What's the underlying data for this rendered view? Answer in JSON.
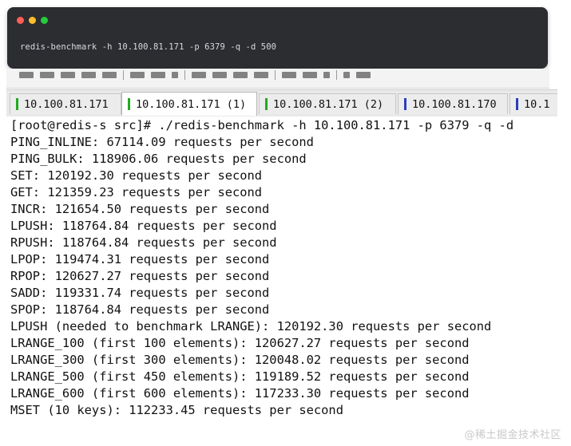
{
  "code_card": {
    "dot_colors": [
      "#ff5f56",
      "#ffbd2e",
      "#27c93f"
    ],
    "command": "redis-benchmark -h 10.100.81.171 -p 6379 -q -d 500"
  },
  "tabs": [
    {
      "label": "10.100.81.171",
      "marker": "green",
      "active": false
    },
    {
      "label": "10.100.81.171 (1)",
      "marker": "green",
      "active": true
    },
    {
      "label": "10.100.81.171 (2)",
      "marker": "green",
      "active": false
    },
    {
      "label": "10.100.81.170",
      "marker": "blue",
      "active": false
    },
    {
      "label": "10.1",
      "marker": "blue",
      "active": false
    }
  ],
  "terminal": {
    "lines": [
      "[root@redis-s src]# ./redis-benchmark -h 10.100.81.171 -p 6379 -q -d",
      "PING_INLINE: 67114.09 requests per second",
      "PING_BULK: 118906.06 requests per second",
      "SET: 120192.30 requests per second",
      "GET: 121359.23 requests per second",
      "INCR: 121654.50 requests per second",
      "LPUSH: 118764.84 requests per second",
      "RPUSH: 118764.84 requests per second",
      "LPOP: 119474.31 requests per second",
      "RPOP: 120627.27 requests per second",
      "SADD: 119331.74 requests per second",
      "SPOP: 118764.84 requests per second",
      "LPUSH (needed to benchmark LRANGE): 120192.30 requests per second",
      "LRANGE_100 (first 100 elements): 120627.27 requests per second",
      "LRANGE_300 (first 300 elements): 120048.02 requests per second",
      "LRANGE_500 (first 450 elements): 119189.52 requests per second",
      "LRANGE_600 (first 600 elements): 117233.30 requests per second",
      "MSET (10 keys): 112233.45 requests per second"
    ]
  },
  "watermark": "@稀土掘金技术社区",
  "colors": {
    "card_bg": "#2b2d31",
    "command_text": "#d7dae0",
    "tab_green": "#22aa22",
    "tab_blue": "#2a3fbf"
  }
}
